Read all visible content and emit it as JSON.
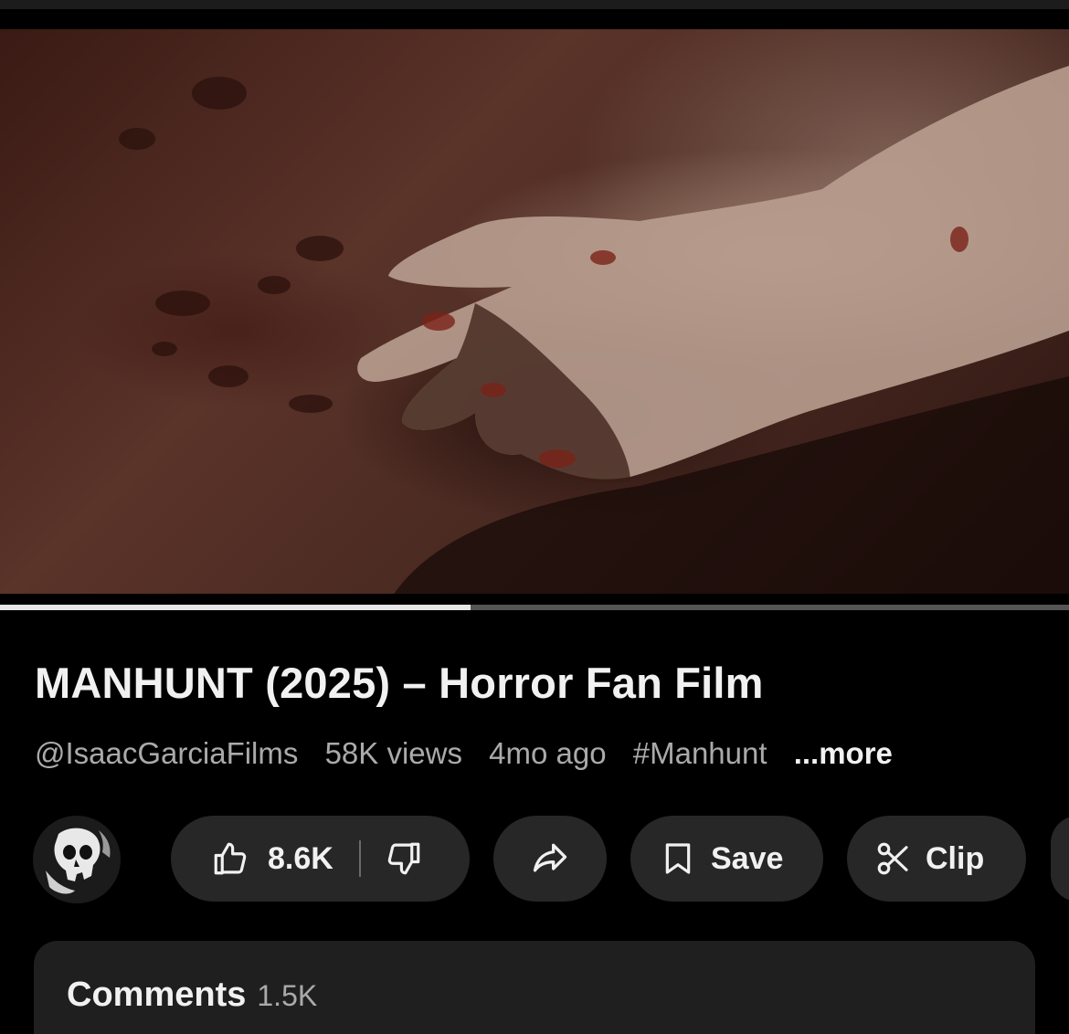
{
  "video": {
    "title": "MANHUNT (2025) – Horror Fan Film",
    "progress_fraction": 0.44
  },
  "meta": {
    "channel": "@IsaacGarciaFilms",
    "views": "58K views",
    "age": "4mo ago",
    "hashtag": "#Manhunt",
    "more": "...more"
  },
  "actions": {
    "likes": "8.6K",
    "save": "Save",
    "clip": "Clip"
  },
  "comments": {
    "label": "Comments",
    "count": "1.5K"
  },
  "icons": {
    "like": "thumbs-up-icon",
    "dislike": "thumbs-down-icon",
    "share": "share-arrow-icon",
    "save": "bookmark-icon",
    "clip": "scissors-icon"
  },
  "colors": {
    "background": "#000000",
    "pill": "#272727",
    "text": "#f1f1f1",
    "muted_text": "#aaaaaa",
    "comments_panel": "#1f1f1f"
  }
}
